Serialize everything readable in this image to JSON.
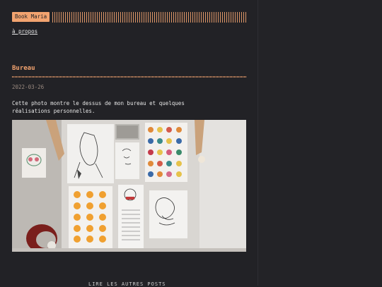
{
  "header": {
    "logo_label": "Book Maria"
  },
  "nav": {
    "about_label": "à propos"
  },
  "post": {
    "title": "Bureau",
    "date": "2022-03-26",
    "text": "Cette photo montre le dessus de mon bureau et quelques réalisations personnelles."
  },
  "footer": {
    "more_posts_label": "LIRE LES AUTRES POSTS"
  },
  "colors": {
    "background": "#222226",
    "accent": "#f2a36f",
    "text": "#e6e6e6",
    "date": "#9a8a80"
  }
}
